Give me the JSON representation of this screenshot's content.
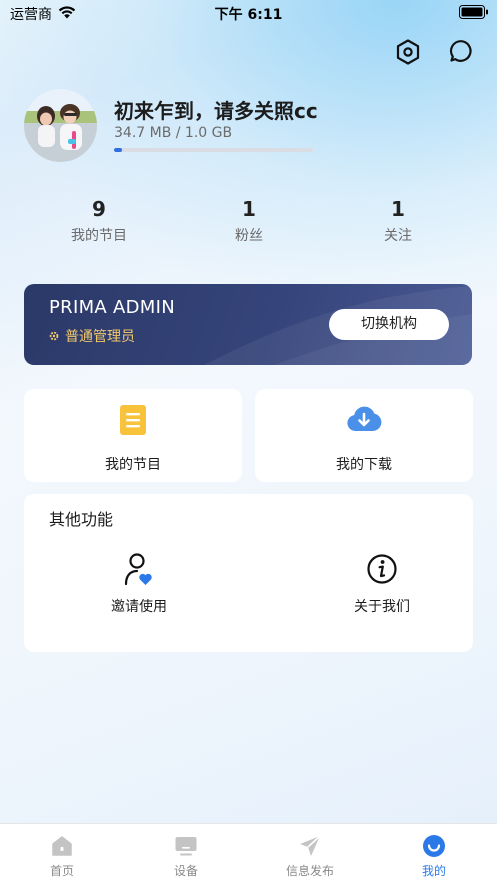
{
  "status_bar": {
    "carrier": "运营商",
    "time": "下午 6:11"
  },
  "profile": {
    "username": "初来乍到，请多关照cc",
    "storage_text": "34.7 MB / 1.0 GB",
    "storage_used_fraction": 0.034
  },
  "stats": [
    {
      "value": "9",
      "label": "我的节目"
    },
    {
      "value": "1",
      "label": "粉丝"
    },
    {
      "value": "1",
      "label": "关注"
    }
  ],
  "organization": {
    "name": "PRIMA ADMIN",
    "role": "普通管理员",
    "switch_label": "切换机构"
  },
  "features": [
    {
      "label": "我的节目",
      "icon": "document-icon"
    },
    {
      "label": "我的下载",
      "icon": "cloud-download-icon"
    }
  ],
  "other": {
    "title": "其他功能",
    "items": [
      {
        "label": "邀请使用",
        "icon": "invite-user-icon"
      },
      {
        "label": "关于我们",
        "icon": "info-icon"
      }
    ]
  },
  "tabs": [
    {
      "label": "首页",
      "icon": "home-icon",
      "active": false
    },
    {
      "label": "设备",
      "icon": "monitor-icon",
      "active": false
    },
    {
      "label": "信息发布",
      "icon": "send-icon",
      "active": false
    },
    {
      "label": "我的",
      "icon": "smile-icon",
      "active": true
    }
  ],
  "colors": {
    "accent": "#2b79e8",
    "org_card": "#2b3968",
    "role_gold": "#f2c86a"
  }
}
